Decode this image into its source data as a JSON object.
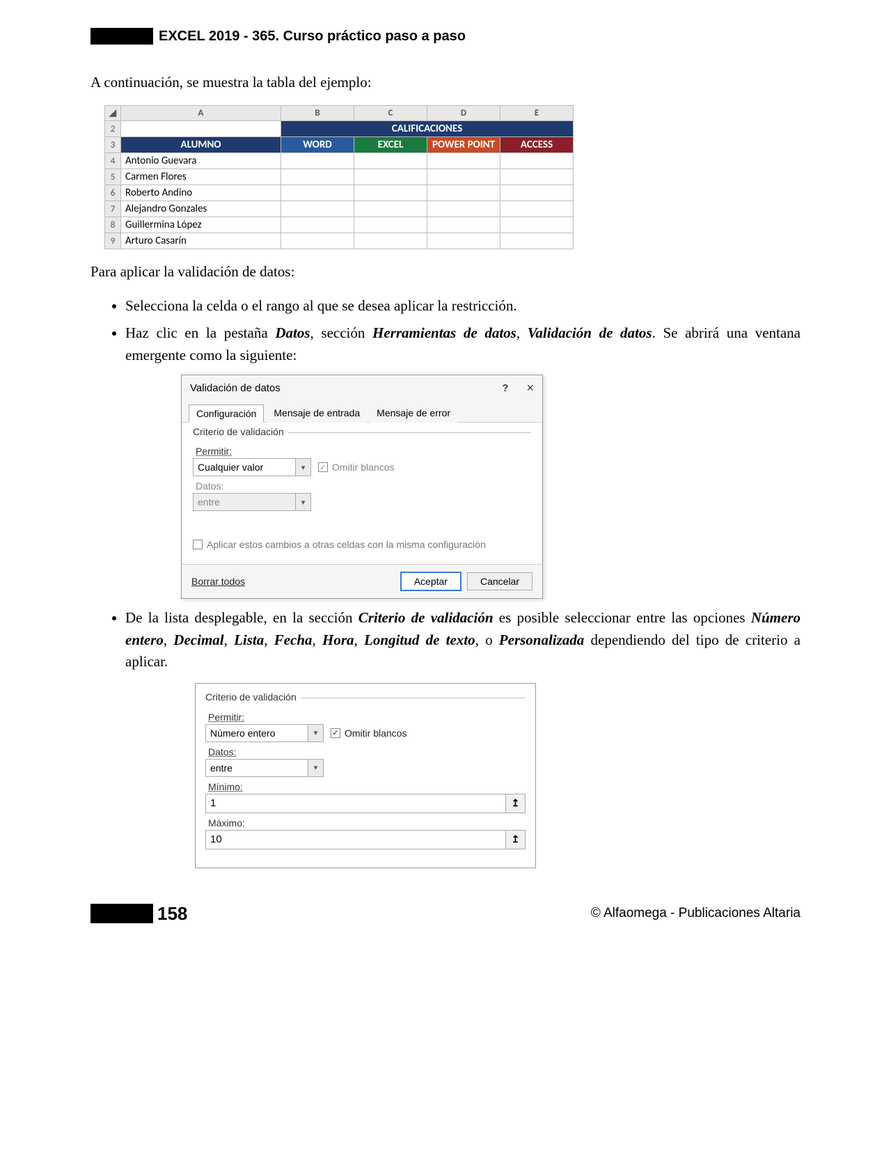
{
  "header": {
    "title": "EXCEL 2019 - 365. Curso práctico paso a paso"
  },
  "intro": "A continuación, se muestra la tabla del ejemplo:",
  "excel_table": {
    "columns": [
      "A",
      "B",
      "C",
      "D",
      "E"
    ],
    "rows": [
      "2",
      "3",
      "4",
      "5",
      "6",
      "7",
      "8",
      "9"
    ],
    "calificaciones": "CALIFICACIONES",
    "headers": {
      "alumno": "ALUMNO",
      "word": "WORD",
      "excel": "EXCEL",
      "powerpoint": "POWER POINT",
      "access": "ACCESS"
    },
    "students": [
      "Antonio Guevara",
      "Carmen Flores",
      "Roberto Andino",
      "Alejandro Gonzales",
      "Guillermina López",
      "Arturo Casarín"
    ]
  },
  "para2": "Para aplicar la validación de datos:",
  "bullet1": "Selecciona la celda o el rango al que se desea aplicar la restricción.",
  "bullet2_before": "Haz clic en la pestaña ",
  "bullet2_b1": "Datos",
  "bullet2_mid1": ", sección ",
  "bullet2_b2": "Herramientas de datos",
  "bullet2_mid2": ", ",
  "bullet2_b3": "Validación de datos",
  "bullet2_after": ". Se abrirá una ventana emergente como la siguiente:",
  "dialog": {
    "title": "Validación de datos",
    "help": "?",
    "close": "×",
    "tabs": [
      "Configuración",
      "Mensaje de entrada",
      "Mensaje de error"
    ],
    "legend": "Criterio de validación",
    "permitir_label": "Permitir:",
    "permitir_value": "Cualquier valor",
    "omitir": "Omitir blancos",
    "datos_label": "Datos:",
    "datos_value": "entre",
    "apply": "Aplicar estos cambios a otras celdas con la misma configuración",
    "borrar": "Borrar todos",
    "aceptar": "Aceptar",
    "cancelar": "Cancelar"
  },
  "bullet3_before": "De la lista desplegable, en la sección ",
  "bullet3_b1": "Criterio de validación",
  "bullet3_mid1": " es posible seleccionar entre las opciones ",
  "bullet3_b2": "Número entero",
  "bullet3_c1": ", ",
  "bullet3_b3": "Decimal",
  "bullet3_c2": ", ",
  "bullet3_b4": "Lista",
  "bullet3_c3": ", ",
  "bullet3_b5": "Fecha",
  "bullet3_c4": ", ",
  "bullet3_b6": "Hora",
  "bullet3_c5": ", ",
  "bullet3_b7": "Longitud de texto",
  "bullet3_mid2": ", o ",
  "bullet3_b8": "Personalizada",
  "bullet3_after": " dependiendo del tipo de criterio a aplicar.",
  "criteria2": {
    "legend": "Criterio de validación",
    "permitir_label": "Permitir:",
    "permitir_value": "Número entero",
    "omitir": "Omitir blancos",
    "datos_label": "Datos:",
    "datos_value": "entre",
    "min_label": "Mínimo:",
    "min_value": "1",
    "max_label": "Máximo:",
    "max_value": "10"
  },
  "footer": {
    "page": "158",
    "copyright": "© Alfaomega - Publicaciones Altaria"
  }
}
